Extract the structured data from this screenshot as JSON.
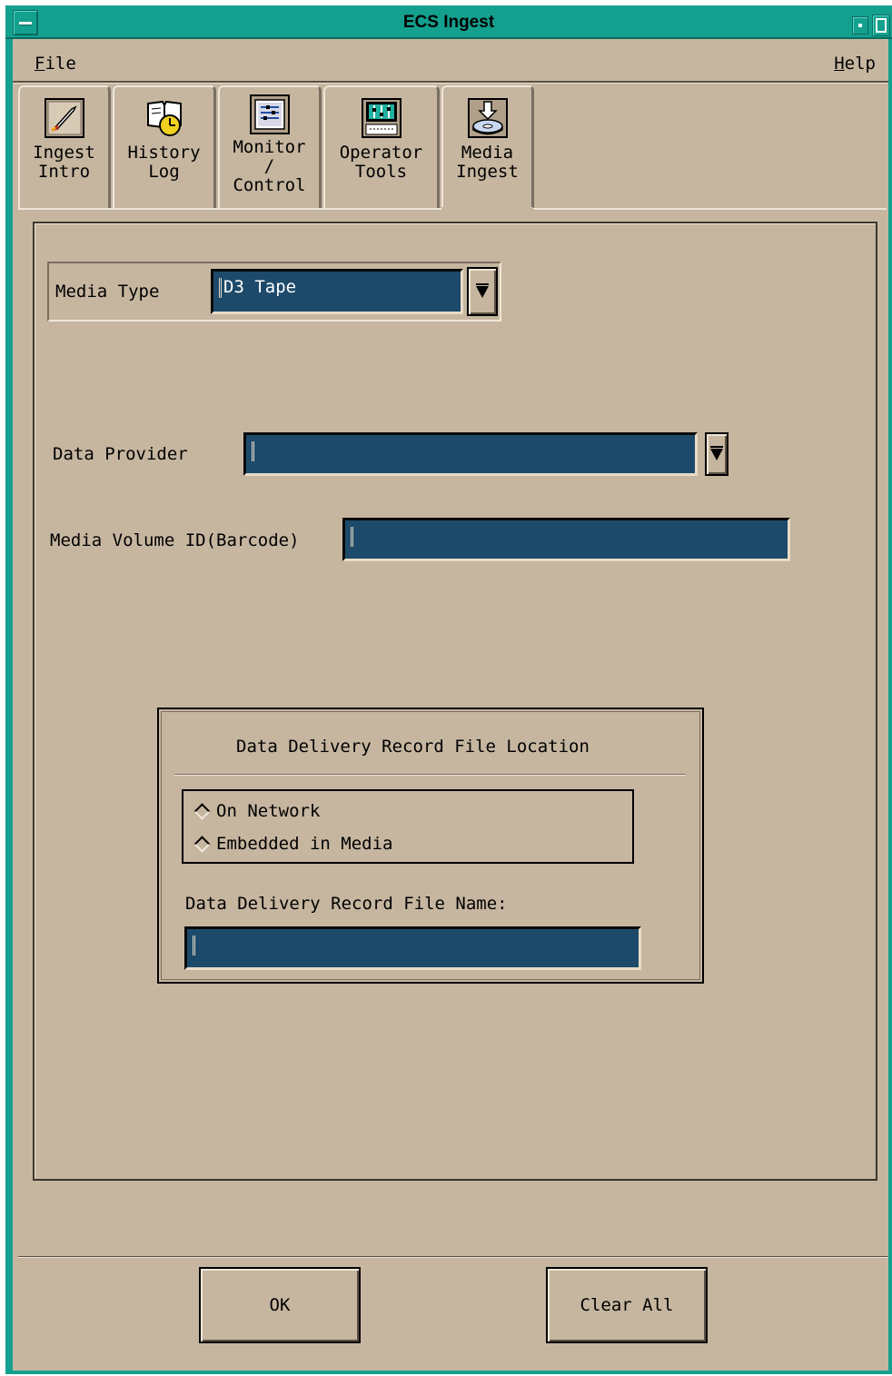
{
  "window": {
    "title": "ECS Ingest"
  },
  "menubar": {
    "file_label": "File",
    "file_mnemonic": "F",
    "file_rest": "ile",
    "help_label": "Help",
    "help_mnemonic": "H",
    "help_rest": "elp"
  },
  "tabs": [
    {
      "label": "Ingest\nIntro",
      "icon": "rocket-icon",
      "active": false
    },
    {
      "label": "History\nLog",
      "icon": "book-clock-icon",
      "active": false
    },
    {
      "label": "Monitor\n/\nControl",
      "icon": "monitor-panel-icon",
      "active": false
    },
    {
      "label": "Operator\nTools",
      "icon": "tools-icon",
      "active": false
    },
    {
      "label": "Media\nIngest",
      "icon": "disk-download-icon",
      "active": true
    }
  ],
  "media_type": {
    "label": "Media Type",
    "value": "D3 Tape"
  },
  "data_provider": {
    "label": "Data Provider",
    "value": ""
  },
  "media_volume": {
    "label": "Media Volume ID(Barcode)",
    "value": ""
  },
  "ddr": {
    "title": "Data Delivery Record File Location",
    "options": [
      "On Network",
      "Embedded in Media"
    ],
    "file_name_label": "Data Delivery Record File Name:",
    "file_name_value": ""
  },
  "buttons": {
    "ok": "OK",
    "clear_all": "Clear All"
  },
  "colors": {
    "window_bg": "#c6b6a0",
    "title_bar": "#14a08e",
    "field_bg": "#1d4a6a"
  }
}
